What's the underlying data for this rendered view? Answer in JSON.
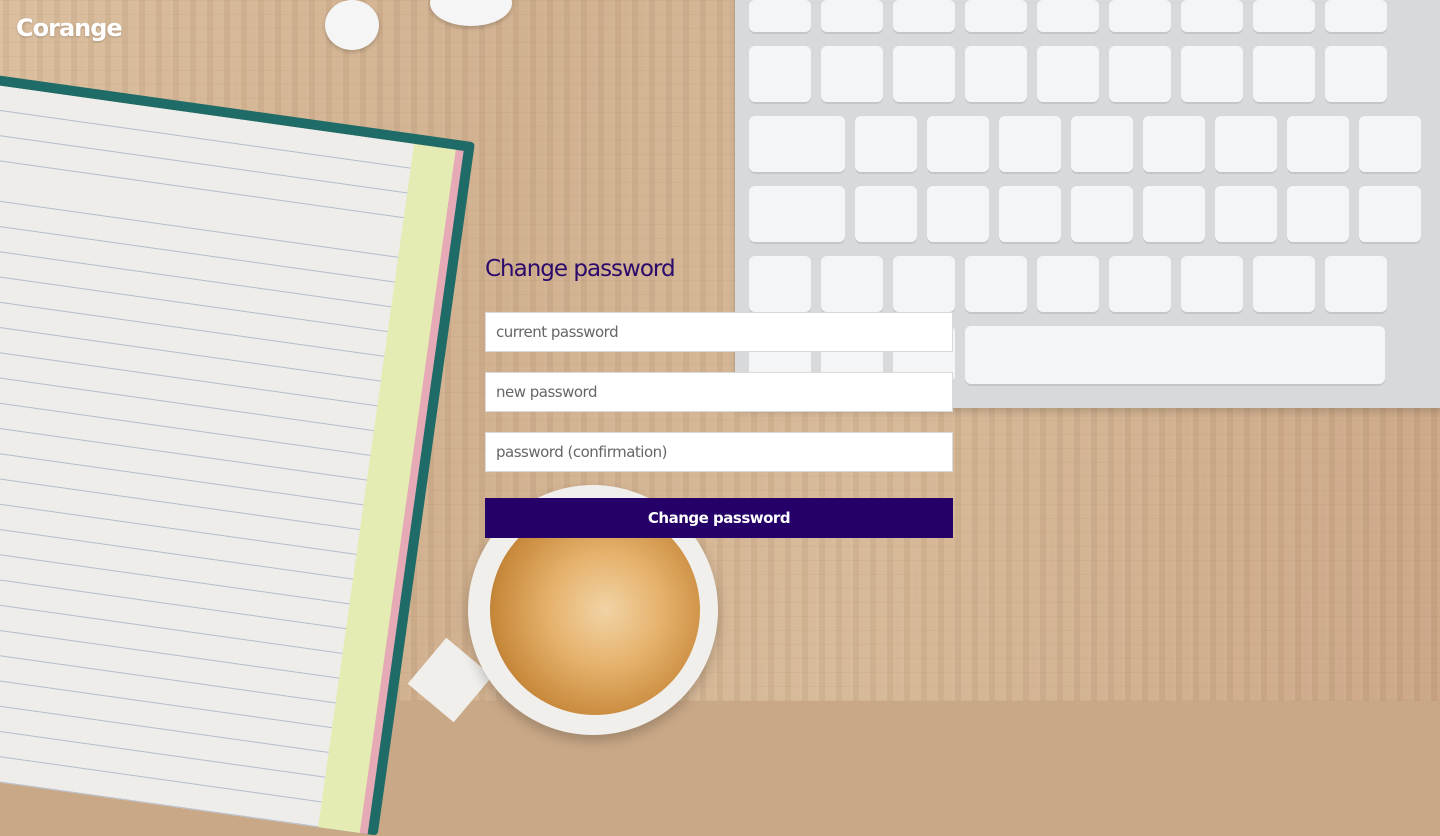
{
  "app": {
    "brand": "Corange"
  },
  "form": {
    "title": "Change password",
    "current_password": {
      "placeholder": "current password",
      "value": ""
    },
    "new_password": {
      "placeholder": "new password",
      "value": ""
    },
    "password_confirmation": {
      "placeholder": "password (confirmation)",
      "value": ""
    },
    "submit_label": "Change password"
  },
  "colors": {
    "accent": "#250068",
    "title": "#2b0a6b",
    "brand_text": "#ffffff"
  }
}
